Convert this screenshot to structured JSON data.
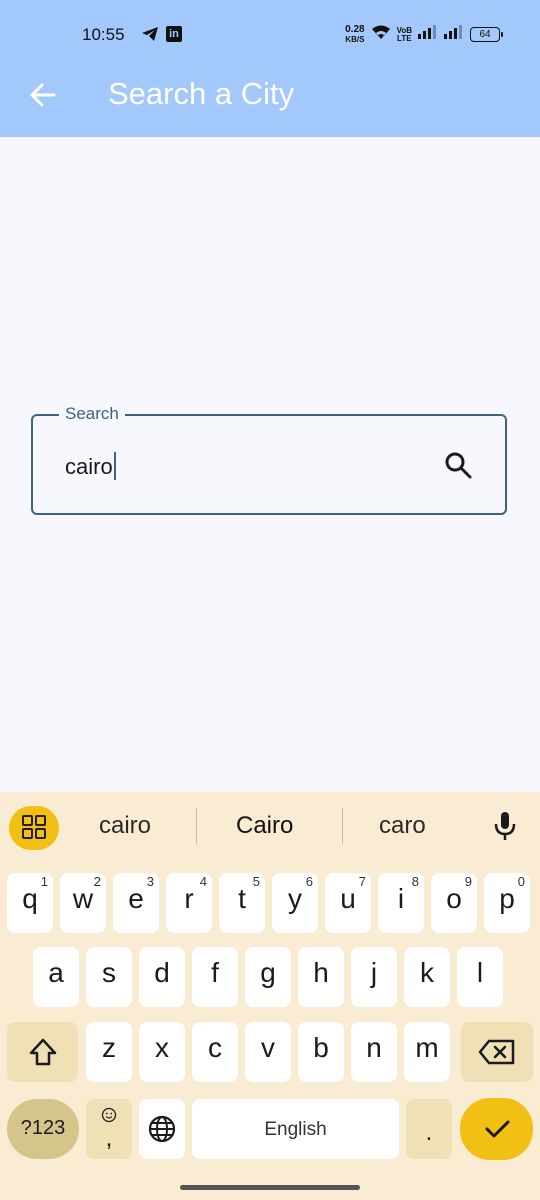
{
  "status_bar": {
    "time": "10:55",
    "net_speed_value": "0.28",
    "net_speed_unit": "KB/S",
    "volte_top": "VoB",
    "volte_bottom": "LTE",
    "battery": "64"
  },
  "app_bar": {
    "title": "Search a City",
    "color": "#a3c8fb"
  },
  "search": {
    "label": "Search",
    "value": "cairo"
  },
  "keyboard": {
    "suggestions": [
      "cairo",
      "Cairo",
      "caro"
    ],
    "row1": [
      {
        "k": "q",
        "n": "1"
      },
      {
        "k": "w",
        "n": "2"
      },
      {
        "k": "e",
        "n": "3"
      },
      {
        "k": "r",
        "n": "4"
      },
      {
        "k": "t",
        "n": "5"
      },
      {
        "k": "y",
        "n": "6"
      },
      {
        "k": "u",
        "n": "7"
      },
      {
        "k": "i",
        "n": "8"
      },
      {
        "k": "o",
        "n": "9"
      },
      {
        "k": "p",
        "n": "0"
      }
    ],
    "row2": [
      "a",
      "s",
      "d",
      "f",
      "g",
      "h",
      "j",
      "k",
      "l"
    ],
    "row3": [
      "z",
      "x",
      "c",
      "v",
      "b",
      "n",
      "m"
    ],
    "symbols_key": "?123",
    "emoji_comma_key": ",",
    "space_label": "English",
    "period_key": ".",
    "accent_color": "#f2bf14"
  }
}
